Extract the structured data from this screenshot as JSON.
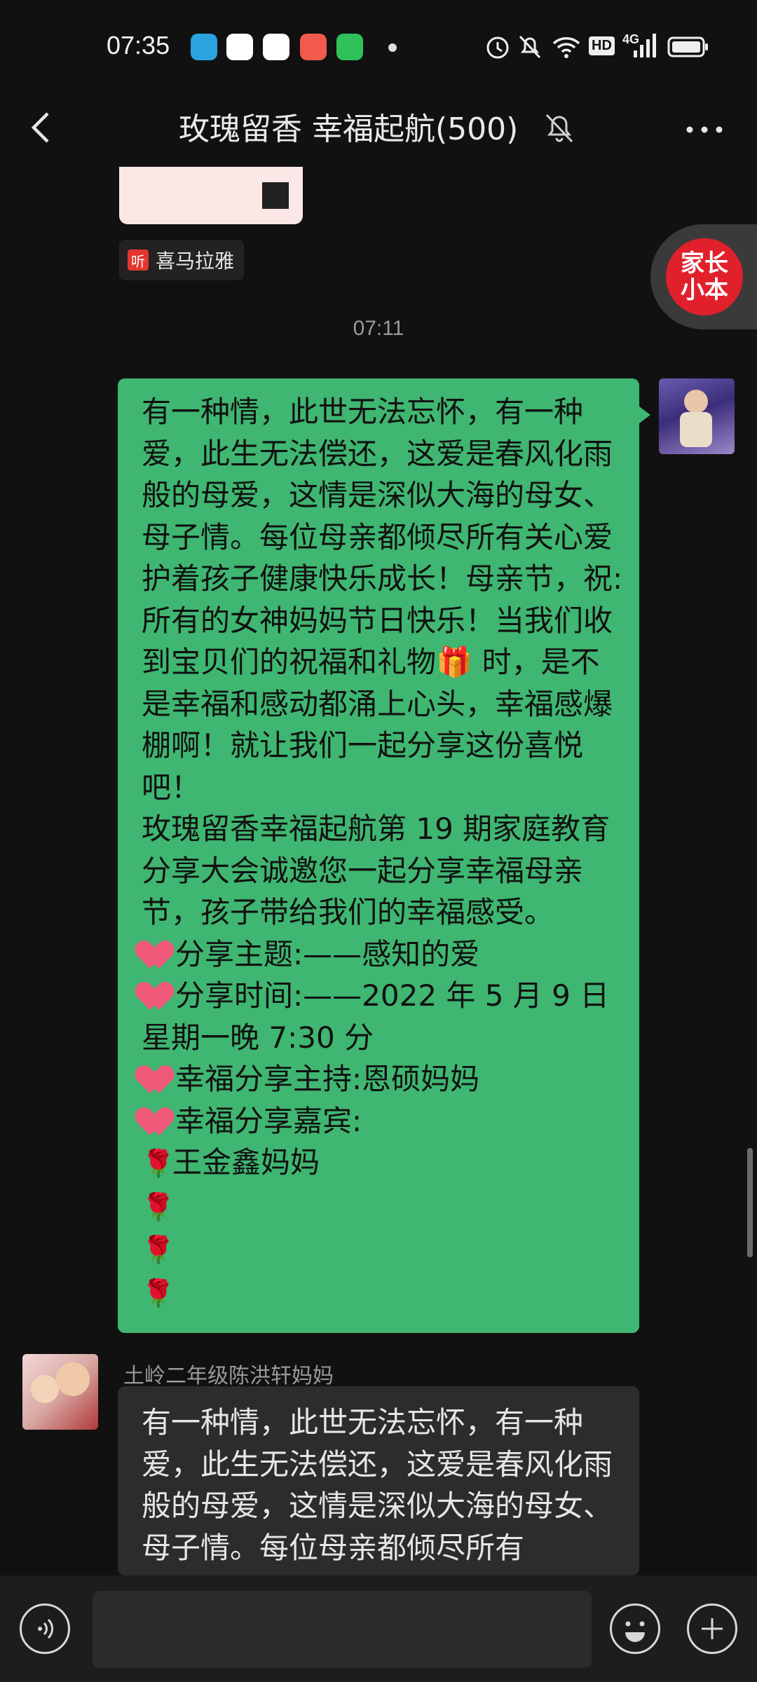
{
  "status_bar": {
    "time": "07:35",
    "app_icons": [
      "telegram-icon",
      "video-app-icon",
      "baidu-icon",
      "photo-app-icon",
      "wechat-mini-icon"
    ],
    "indicators": [
      "alarm-icon",
      "mute-icon",
      "wifi-icon",
      "HD",
      "4G",
      "signal-icon",
      "battery-icon"
    ],
    "hd_label": "HD",
    "network_label": "4G"
  },
  "header": {
    "title": "玫瑰留香  幸福起航(500)",
    "muted": true
  },
  "audio_card": {
    "source_name": "喜马拉雅",
    "source_icon_char": "听"
  },
  "floating_button": {
    "label": "家长\n小本"
  },
  "timestamp": "07:11",
  "my_message": {
    "lines": [
      "有一种情，此世无法忘怀，有一种爱，此生无法偿还，这爱是春风化雨般的母爱，这情是深似大海的母女、母子情。每位母亲都倾尽所有关心爱护着孩子健康快乐成长！母亲节，祝:所有的女神妈妈节日快乐！当我们收到宝贝们的祝福和礼物🎁 时，是不是幸福和感动都涌上心头，幸福感爆棚啊！就让我们一起分享这份喜悦吧！",
      "玫瑰留香幸福起航第 19 期家庭教育分享大会诚邀您一起分享幸福母亲节，孩子带给我们的幸福感受。"
    ],
    "items": [
      {
        "text": "分享主题:——感知的爱"
      },
      {
        "text": "分享时间:——2022 年 5 月 9 日星期一晚 7:30 分"
      },
      {
        "text": "幸福分享主持:恩硕妈妈"
      },
      {
        "text": "幸福分享嘉宾:"
      }
    ],
    "guests": [
      "王金鑫妈妈",
      "",
      "",
      ""
    ]
  },
  "other_message": {
    "sender": "土岭二年级陈洪轩妈妈",
    "text": "有一种情，此世无法忘怀，有一种爱，此生无法偿还，这爱是春风化雨般的母爱，这情是深似大海的母女、母子情。每位母亲都倾尽所有"
  },
  "colors": {
    "background": "#111111",
    "my_bubble": "#3fb671",
    "other_bubble": "#2c2c2c",
    "bottom_bar": "#1d1d1d"
  }
}
